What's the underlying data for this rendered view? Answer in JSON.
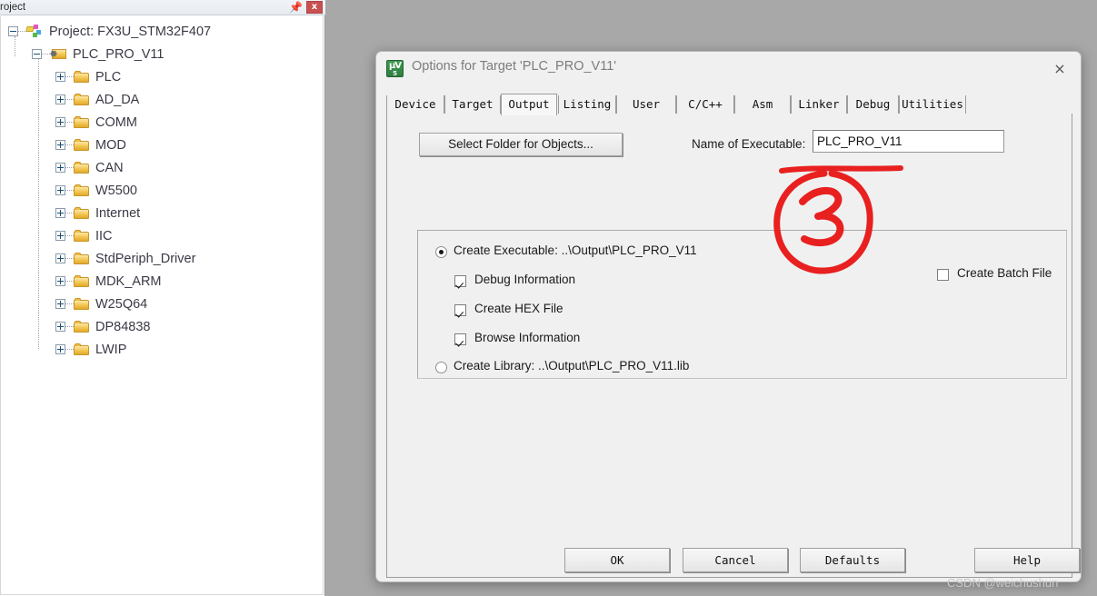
{
  "project_panel": {
    "title": "roject",
    "pin_icon": "pin-icon",
    "close_label": "x",
    "tree": [
      {
        "label": "Project: FX3U_STM32F407",
        "depth": 0,
        "icon": "project-icon",
        "expander": "minus"
      },
      {
        "label": "PLC_PRO_V11",
        "depth": 1,
        "icon": "target-group-icon",
        "expander": "minus"
      },
      {
        "label": "PLC",
        "depth": 2,
        "icon": "folder-icon",
        "expander": "plus"
      },
      {
        "label": "AD_DA",
        "depth": 2,
        "icon": "folder-icon",
        "expander": "plus"
      },
      {
        "label": "COMM",
        "depth": 2,
        "icon": "folder-icon",
        "expander": "plus"
      },
      {
        "label": "MOD",
        "depth": 2,
        "icon": "folder-icon",
        "expander": "plus"
      },
      {
        "label": "CAN",
        "depth": 2,
        "icon": "folder-icon",
        "expander": "plus"
      },
      {
        "label": "W5500",
        "depth": 2,
        "icon": "folder-icon",
        "expander": "plus"
      },
      {
        "label": "Internet",
        "depth": 2,
        "icon": "folder-icon",
        "expander": "plus"
      },
      {
        "label": "IIC",
        "depth": 2,
        "icon": "folder-icon",
        "expander": "plus"
      },
      {
        "label": "StdPeriph_Driver",
        "depth": 2,
        "icon": "folder-icon",
        "expander": "plus"
      },
      {
        "label": "MDK_ARM",
        "depth": 2,
        "icon": "folder-icon",
        "expander": "plus"
      },
      {
        "label": "W25Q64",
        "depth": 2,
        "icon": "folder-icon",
        "expander": "plus"
      },
      {
        "label": "DP84838",
        "depth": 2,
        "icon": "folder-icon",
        "expander": "plus"
      },
      {
        "label": "LWIP",
        "depth": 2,
        "icon": "folder-icon",
        "expander": "plus"
      }
    ]
  },
  "dialog": {
    "title": "Options for Target 'PLC_PRO_V11'",
    "app_icon_top": "μV",
    "app_icon_bottom": "5",
    "close_icon": "×",
    "tabs": [
      {
        "label": "Device",
        "active": false
      },
      {
        "label": "Target",
        "active": false
      },
      {
        "label": "Output",
        "active": true
      },
      {
        "label": "Listing",
        "active": false
      },
      {
        "label": "User",
        "active": false
      },
      {
        "label": "C/C++",
        "active": false
      },
      {
        "label": "Asm",
        "active": false
      },
      {
        "label": "Linker",
        "active": false
      },
      {
        "label": "Debug",
        "active": false
      },
      {
        "label": "Utilities",
        "active": false
      }
    ],
    "output_tab": {
      "select_folder_button": "Select Folder for Objects...",
      "name_of_executable_label": "Name of Executable:",
      "name_of_executable_value": "PLC_PRO_V11",
      "create_executable": {
        "label": "Create Executable:  ..\\Output\\PLC_PRO_V11",
        "selected": true
      },
      "create_library": {
        "label": "Create Library:  ..\\Output\\PLC_PRO_V11.lib",
        "selected": false
      },
      "checkboxes": [
        {
          "label": "Debug Information",
          "checked": true
        },
        {
          "label": "Create HEX File",
          "checked": true
        },
        {
          "label": "Browse Information",
          "checked": true
        }
      ],
      "create_batch_file": {
        "label": "Create Batch File",
        "checked": false
      }
    },
    "buttons": [
      {
        "label": "OK"
      },
      {
        "label": "Cancel"
      },
      {
        "label": "Defaults"
      },
      {
        "label": "Help"
      }
    ]
  },
  "annotation": {
    "mark": "3",
    "color": "#e8201f"
  },
  "watermark": "CSDN @weichushun"
}
